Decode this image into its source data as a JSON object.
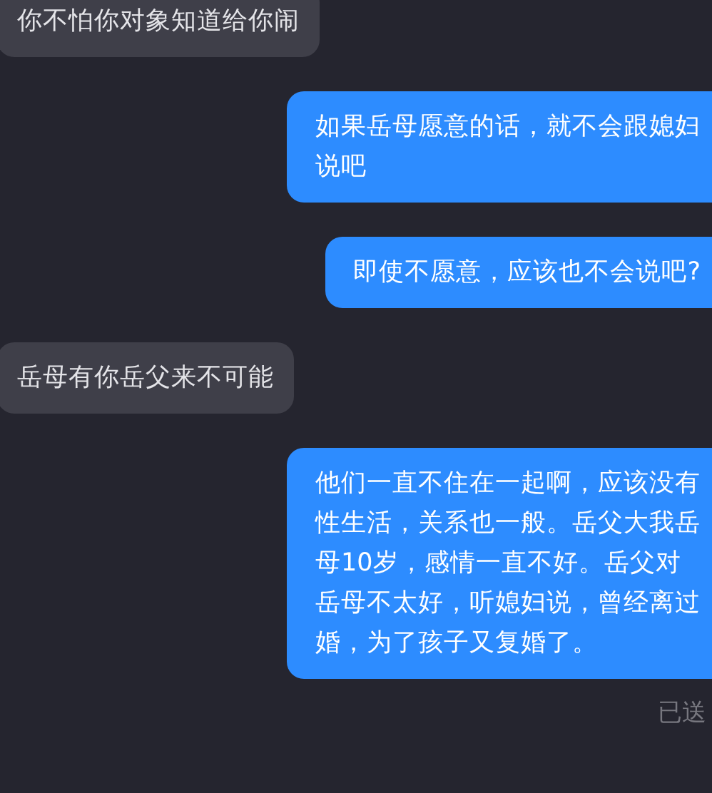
{
  "messages": [
    {
      "kind": "incoming",
      "text": "你不怕你对象知道给你闹"
    },
    {
      "kind": "outgoing",
      "text": "如果岳母愿意的话，就不会跟媳妇说吧"
    },
    {
      "kind": "outgoing",
      "text": "即使不愿意，应该也不会说吧?"
    },
    {
      "kind": "incoming",
      "text": "岳母有你岳父来不可能"
    },
    {
      "kind": "outgoing",
      "text": "他们一直不住在一起啊，应该没有性生活，关系也一般。岳父大我岳母10岁，感情一直不好。岳父对岳母不太好，听媳妇说，曾经离过婚，为了孩子又复婚了。"
    }
  ],
  "status": "已送"
}
